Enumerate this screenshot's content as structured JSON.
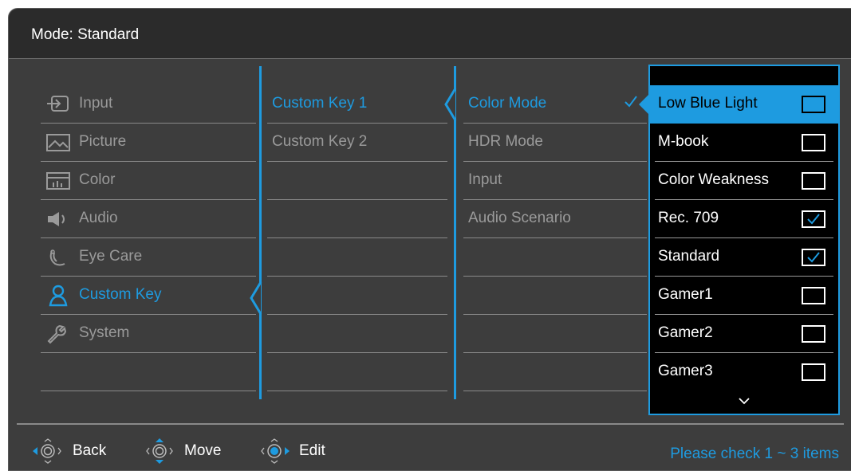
{
  "header": {
    "title": "Mode: Standard"
  },
  "menu": {
    "items": [
      {
        "label": "Input",
        "icon": "input-icon"
      },
      {
        "label": "Picture",
        "icon": "picture-icon"
      },
      {
        "label": "Color",
        "icon": "color-icon"
      },
      {
        "label": "Audio",
        "icon": "speaker-icon"
      },
      {
        "label": "Eye Care",
        "icon": "eye-care-icon"
      },
      {
        "label": "Custom Key",
        "icon": "user-icon",
        "active": true
      },
      {
        "label": "System",
        "icon": "wrench-icon"
      }
    ]
  },
  "submenu": {
    "items": [
      {
        "label": "Custom Key 1",
        "active": true
      },
      {
        "label": "Custom Key 2"
      }
    ]
  },
  "options": {
    "items": [
      {
        "label": "Color Mode",
        "active": true,
        "checked": true
      },
      {
        "label": "HDR Mode"
      },
      {
        "label": "Input"
      },
      {
        "label": "Audio Scenario"
      }
    ]
  },
  "panel": {
    "items": [
      {
        "label": "Low Blue Light",
        "checked": false,
        "selected": true
      },
      {
        "label": "M-book",
        "checked": false
      },
      {
        "label": "Color Weakness",
        "checked": false
      },
      {
        "label": "Rec. 709",
        "checked": true
      },
      {
        "label": "Standard",
        "checked": true
      },
      {
        "label": "Gamer1",
        "checked": false
      },
      {
        "label": "Gamer2",
        "checked": false
      },
      {
        "label": "Gamer3",
        "checked": false
      }
    ],
    "more_icon": "chevron-down-icon"
  },
  "footer": {
    "back": "Back",
    "move": "Move",
    "edit": "Edit",
    "hint": "Please check 1 ~ 3 items"
  },
  "colors": {
    "accent": "#1e9be0",
    "background": "#3d3d3d",
    "header": "#2b2b2b"
  }
}
